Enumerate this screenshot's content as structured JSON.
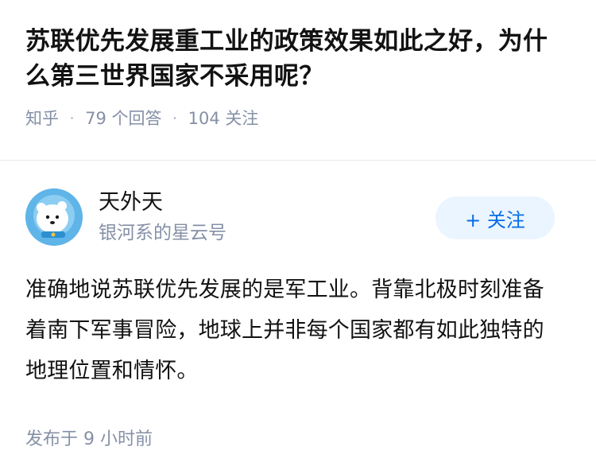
{
  "question": {
    "title": "苏联优先发展重工业的政策效果如此之好，为什么第三世界国家不采用呢？",
    "source": "知乎",
    "answers_count": "79 个回答",
    "followers_count": "104 关注"
  },
  "answer": {
    "author_name": "天外天",
    "author_bio": "银河系的星云号",
    "follow_button": "+ 关注",
    "content": "准确地说苏联优先发展的是军工业。背靠北极时刻准备着南下军事冒险，地球上并非每个国家都有如此独特的地理位置和情怀。",
    "published": "发布于  9 小时前"
  },
  "colors": {
    "accent": "#056de8",
    "follow_bg": "#ebf5ff",
    "meta": "#8590a6",
    "avatar_bg": "#5fb4e8"
  }
}
